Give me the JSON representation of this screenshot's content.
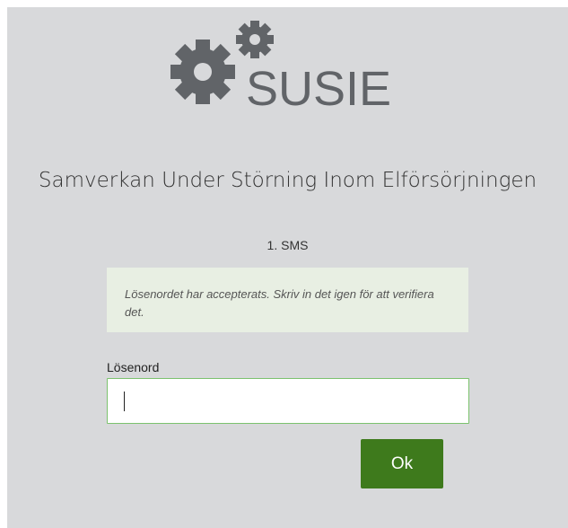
{
  "logo": {
    "text": "SUSIE",
    "icon": "gears-icon",
    "color": "#616468"
  },
  "app_title": "Samverkan Under Störning Inom Elförsörjningen",
  "step_label": "1. SMS",
  "info_message": "Lösenordet har accepterats. Skriv in det igen för att verifiera det.",
  "password": {
    "label": "Lösenord",
    "value": "",
    "placeholder": ""
  },
  "ok_button": {
    "label": "Ok",
    "color": "#3e7a1c"
  },
  "colors": {
    "panel_background": "#d8d9db",
    "info_background": "#e8efe3",
    "input_border": "#7cc26e"
  }
}
